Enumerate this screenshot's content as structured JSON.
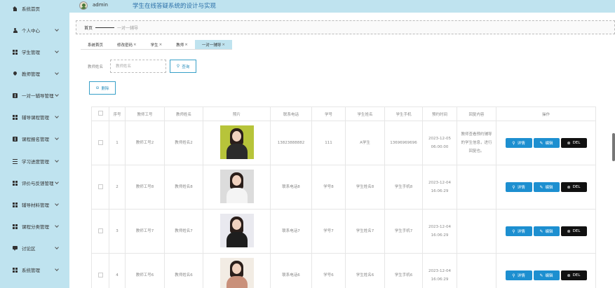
{
  "header": {
    "username": "admin",
    "title": "学生在线答疑系统的设计与实现"
  },
  "sidebar": {
    "items": [
      {
        "label": "系统首页",
        "icon": "home-icon",
        "expandable": false
      },
      {
        "label": "个人中心",
        "icon": "user-icon",
        "expandable": true
      },
      {
        "label": "学生管理",
        "icon": "grid-icon",
        "expandable": true
      },
      {
        "label": "教师管理",
        "icon": "pin-icon",
        "expandable": true
      },
      {
        "label": "一对一辅导管理",
        "icon": "book-icon",
        "expandable": true
      },
      {
        "label": "辅导课程管理",
        "icon": "grid-icon",
        "expandable": true
      },
      {
        "label": "课程报名管理",
        "icon": "book-icon",
        "expandable": true
      },
      {
        "label": "学习进度管理",
        "icon": "list-icon",
        "expandable": true
      },
      {
        "label": "评价与反馈管理",
        "icon": "grid-icon",
        "expandable": true
      },
      {
        "label": "辅导材料管理",
        "icon": "grid-icon",
        "expandable": true
      },
      {
        "label": "课程分类管理",
        "icon": "grid-icon",
        "expandable": true
      },
      {
        "label": "讨论区",
        "icon": "chat-icon",
        "expandable": true
      },
      {
        "label": "系统管理",
        "icon": "grid-icon",
        "expandable": true
      }
    ]
  },
  "breadcrumb": {
    "home": "首页",
    "current": "一对一辅导"
  },
  "tabs": [
    {
      "label": "系统首页",
      "closable": false,
      "active": false
    },
    {
      "label": "修改密码",
      "closable": true,
      "active": false
    },
    {
      "label": "学生",
      "closable": true,
      "active": false
    },
    {
      "label": "教师",
      "closable": true,
      "active": false
    },
    {
      "label": "一对一辅导",
      "closable": true,
      "active": true
    }
  ],
  "tab_close_glyph": "×",
  "search": {
    "label": "教师姓名",
    "placeholder": "教师姓名",
    "value": "",
    "button_label": "查询"
  },
  "delete_label": "删除",
  "table": {
    "columns": [
      "",
      "序号",
      "教师工号",
      "教师姓名",
      "照片",
      "联系电话",
      "学号",
      "学生姓名",
      "学生手机",
      "预约时间",
      "回复内容",
      "操作"
    ],
    "rows": [
      {
        "index": "1",
        "teacher_id": "教师工号2",
        "teacher_name": "教师姓名2",
        "phone": "13823888882",
        "student_id": "111",
        "student_name": "A学生",
        "student_phone": "13696969696",
        "time": "2023-12-05 06:00:00",
        "reply": "教师查看预约辅导的学生信息，进行回复也。",
        "photo": {
          "bg": "#b7c43a",
          "body": "#2b2b2b"
        }
      },
      {
        "index": "2",
        "teacher_id": "教师工号8",
        "teacher_name": "教师姓名8",
        "phone": "联系电话8",
        "student_id": "学号8",
        "student_name": "学生姓名8",
        "student_phone": "学生手机8",
        "time": "2023-12-04 16:06:29",
        "reply": "",
        "photo": {
          "bg": "#dcdcdc",
          "body": "#f4f4f4"
        }
      },
      {
        "index": "3",
        "teacher_id": "教师工号7",
        "teacher_name": "教师姓名7",
        "phone": "联系电话7",
        "student_id": "学号7",
        "student_name": "学生姓名7",
        "student_phone": "学生手机7",
        "time": "2023-12-04 16:06:29",
        "reply": "",
        "photo": {
          "bg": "#e9e9ef",
          "body": "#1e1e1e"
        }
      },
      {
        "index": "4",
        "teacher_id": "教师工号6",
        "teacher_name": "教师姓名6",
        "phone": "联系电话6",
        "student_id": "学号6",
        "student_name": "学生姓名6",
        "student_phone": "学生手机6",
        "time": "2023-12-04 16:06:29",
        "reply": "",
        "photo": {
          "bg": "#f2ece4",
          "body": "#c9907a"
        }
      }
    ]
  },
  "actions": {
    "detail": "详情",
    "edit": "编辑",
    "delete": "DEL"
  },
  "glyphs": {
    "search": "⚲",
    "edit": "✎",
    "delete": "⊗",
    "remove": "⊖"
  }
}
